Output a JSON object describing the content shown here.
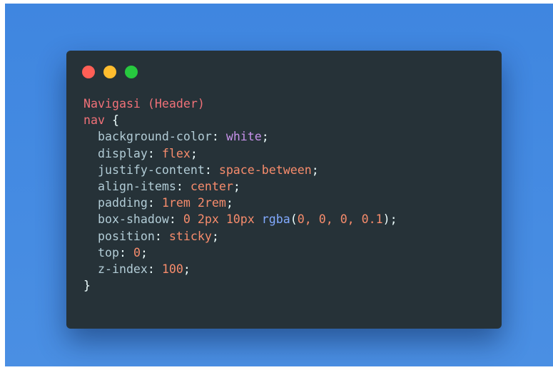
{
  "colors": {
    "background": "#4289e1",
    "window": "#263238",
    "dot_red": "#ff5f56",
    "dot_yellow": "#ffbd2e",
    "dot_green": "#27c93f"
  },
  "window_controls": [
    {
      "name": "close-dot",
      "color": "#ff5f56"
    },
    {
      "name": "minimize-dot",
      "color": "#ffbd2e"
    },
    {
      "name": "zoom-dot",
      "color": "#27c93f"
    }
  ],
  "code": {
    "comment": "Navigasi (Header)",
    "selector": "nav",
    "open_brace": "{",
    "close_brace": "}",
    "declarations": [
      {
        "property": "background-color",
        "value": "white"
      },
      {
        "property": "display",
        "value": "flex"
      },
      {
        "property": "justify-content",
        "value": "space-between"
      },
      {
        "property": "align-items",
        "value": "center"
      },
      {
        "property": "padding",
        "value": "1rem 2rem"
      },
      {
        "property": "box-shadow",
        "func_prefix": "0 2px 10px",
        "func_name": "rgba",
        "func_args": "0, 0, 0, 0.1"
      },
      {
        "property": "position",
        "value": "sticky"
      },
      {
        "property": "top",
        "value": "0"
      },
      {
        "property": "z-index",
        "value": "100"
      }
    ]
  }
}
